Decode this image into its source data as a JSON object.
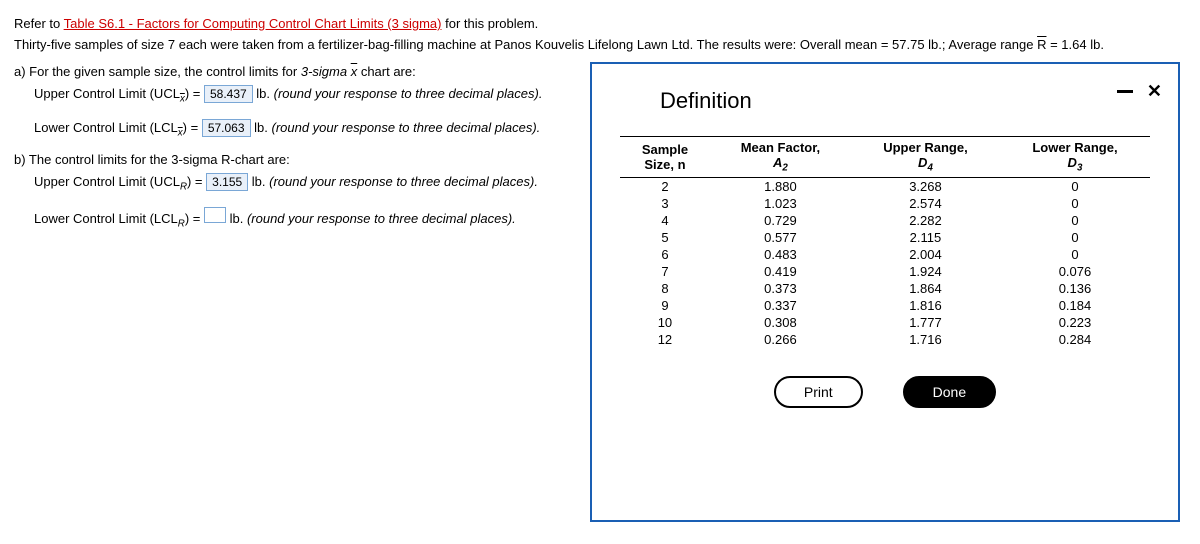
{
  "intro": {
    "refer_prefix": "Refer to ",
    "table_link": "Table S6.1 - Factors for Computing Control Chart Limits (3 sigma)",
    "refer_suffix": " for this problem.",
    "scenario_a": "Thirty-five samples of size 7 each were taken from a fertilizer-bag-filling machine at Panos Kouvelis Lifelong Lawn Ltd. The results were: Overall mean = 57.75 lb.; Average range ",
    "rbar": "R",
    "scenario_b": " = 1.64 lb."
  },
  "partA": {
    "prompt_a": "a) For the given sample size, the control limits for ",
    "prompt_b": "3-sigma ",
    "xbar": "x",
    "prompt_c": " chart are:",
    "ucl_label_a": "Upper Control Limit (UCL",
    "ucl_label_b": ") = ",
    "ucl_val": "58.437",
    "lcl_label_a": "Lower Control Limit (LCL",
    "lcl_label_b": ") = ",
    "lcl_val": "57.063",
    "unit": " lb. ",
    "round": "(round your response to three decimal places)."
  },
  "partB": {
    "prompt": "b) The control limits for the 3-sigma R-chart are:",
    "ucl_label_a": "Upper Control Limit (UCL",
    "sub_r": "R",
    "ucl_label_b": ") = ",
    "ucl_val": "3.155",
    "lcl_label_a": "Lower Control Limit (LCL",
    "lcl_label_b": ") = ",
    "lcl_val": "",
    "unit": " lb. ",
    "round": "(round your response to three decimal places)."
  },
  "popup": {
    "title": "Definition",
    "headers": {
      "c1a": "Sample",
      "c1b": "Size, n",
      "c2a": "Mean Factor,",
      "c2b": "A",
      "c2sub": "2",
      "c3a": "Upper Range,",
      "c3b": "D",
      "c3sub": "4",
      "c4a": "Lower Range,",
      "c4b": "D",
      "c4sub": "3"
    },
    "rows": [
      {
        "n": "2",
        "a2": "1.880",
        "d4": "3.268",
        "d3": "0"
      },
      {
        "n": "3",
        "a2": "1.023",
        "d4": "2.574",
        "d3": "0"
      },
      {
        "n": "4",
        "a2": "0.729",
        "d4": "2.282",
        "d3": "0"
      },
      {
        "n": "5",
        "a2": "0.577",
        "d4": "2.115",
        "d3": "0"
      },
      {
        "n": "6",
        "a2": "0.483",
        "d4": "2.004",
        "d3": "0"
      },
      {
        "n": "7",
        "a2": "0.419",
        "d4": "1.924",
        "d3": "0.076"
      },
      {
        "n": "8",
        "a2": "0.373",
        "d4": "1.864",
        "d3": "0.136"
      },
      {
        "n": "9",
        "a2": "0.337",
        "d4": "1.816",
        "d3": "0.184"
      },
      {
        "n": "10",
        "a2": "0.308",
        "d4": "1.777",
        "d3": "0.223"
      },
      {
        "n": "12",
        "a2": "0.266",
        "d4": "1.716",
        "d3": "0.284"
      }
    ],
    "print": "Print",
    "done": "Done"
  }
}
